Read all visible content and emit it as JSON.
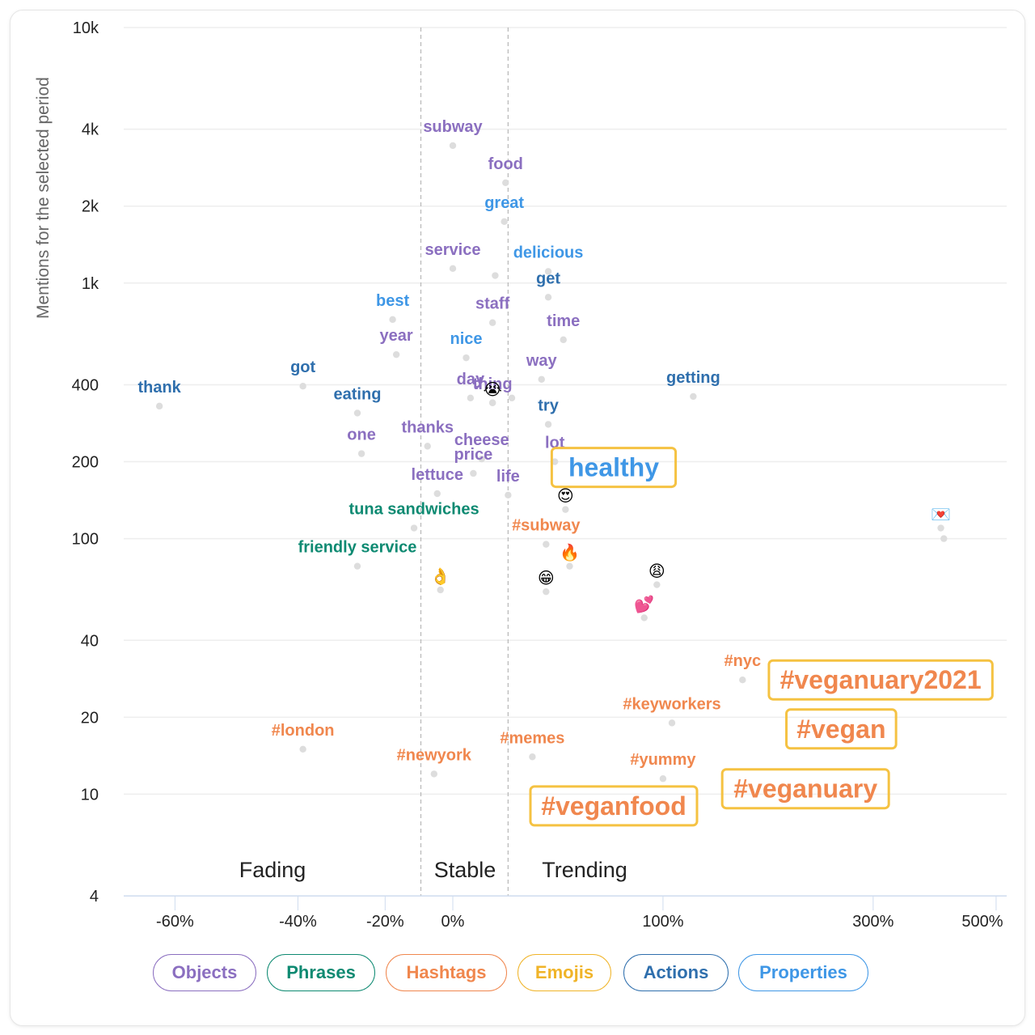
{
  "chart_data": {
    "type": "scatter",
    "title": "",
    "ylabel": "Mentions for the selected period",
    "xlabel": "",
    "y_scale": "log",
    "x_scale": "log(1+x)",
    "ylim": [
      4,
      10000
    ],
    "xlim": [
      -0.7,
      0.5
    ],
    "y_ticks": [
      {
        "value": 10000,
        "label": "10k"
      },
      {
        "value": 4000,
        "label": "4k"
      },
      {
        "value": 2000,
        "label": "2k"
      },
      {
        "value": 1000,
        "label": "1k"
      },
      {
        "value": 400,
        "label": "400"
      },
      {
        "value": 200,
        "label": "200"
      },
      {
        "value": 100,
        "label": "100"
      },
      {
        "value": 40,
        "label": "40"
      },
      {
        "value": 20,
        "label": "20"
      },
      {
        "value": 10,
        "label": "10"
      },
      {
        "value": 4,
        "label": "4"
      }
    ],
    "x_ticks": [
      {
        "value": -60,
        "label": "-60%"
      },
      {
        "value": -40,
        "label": "-40%"
      },
      {
        "value": -20,
        "label": "-20%"
      },
      {
        "value": 0,
        "label": "0%"
      },
      {
        "value": 100,
        "label": "100%"
      },
      {
        "value": 300,
        "label": "300%"
      },
      {
        "value": 500,
        "label": "500%"
      }
    ],
    "zone_boundaries": [
      -10,
      20
    ],
    "zones": [
      {
        "label": "Fading",
        "center": -45
      },
      {
        "label": "Stable",
        "center": 6
      },
      {
        "label": "Trending",
        "center": 60
      }
    ],
    "grid": true,
    "legend_placement": "bottom",
    "categories": {
      "Objects": "#8b6fc0",
      "Phrases": "#0e8a72",
      "Hashtags": "#f0874e",
      "Emojis": "#f0b429",
      "Actions": "#2f6fad",
      "Properties": "#3f97e6"
    },
    "highlight_color": "#f5c242",
    "dot_color": "#dddddd",
    "points": [
      {
        "label": "subway",
        "cat": "Objects",
        "change": 0,
        "mentions": 3450
      },
      {
        "label": "food",
        "cat": "Objects",
        "change": 19,
        "mentions": 2470
      },
      {
        "label": "great",
        "cat": "Properties",
        "change": 18.5,
        "mentions": 1740
      },
      {
        "label": "service",
        "cat": "Objects",
        "change": 0,
        "mentions": 1140
      },
      {
        "label": "",
        "cat": "Objects",
        "change": 15,
        "mentions": 1070
      },
      {
        "label": "delicious",
        "cat": "Properties",
        "change": 37,
        "mentions": 1110
      },
      {
        "label": "get",
        "cat": "Actions",
        "change": 37,
        "mentions": 880
      },
      {
        "label": "best",
        "cat": "Properties",
        "change": -18,
        "mentions": 720
      },
      {
        "label": "staff",
        "cat": "Objects",
        "change": 14,
        "mentions": 700
      },
      {
        "label": "time",
        "cat": "Objects",
        "change": 44,
        "mentions": 600
      },
      {
        "label": "year",
        "cat": "Objects",
        "change": -17,
        "mentions": 525
      },
      {
        "label": "nice",
        "cat": "Properties",
        "change": 4.5,
        "mentions": 510
      },
      {
        "label": "way",
        "cat": "Objects",
        "change": 34,
        "mentions": 420
      },
      {
        "label": "got",
        "cat": "Actions",
        "change": -39,
        "mentions": 395
      },
      {
        "label": "getting",
        "cat": "Actions",
        "change": 121,
        "mentions": 360
      },
      {
        "label": "day",
        "cat": "Objects",
        "change": 6,
        "mentions": 355
      },
      {
        "label": "",
        "cat": "Objects",
        "change": 21.5,
        "mentions": 355
      },
      {
        "label": "thing",
        "cat": "Objects",
        "change": 14,
        "mentions": 340
      },
      {
        "label": "😭",
        "cat": "Emojis",
        "change": 14,
        "mentions": 340
      },
      {
        "label": "thank",
        "cat": "Actions",
        "change": -62,
        "mentions": 330
      },
      {
        "label": "eating",
        "cat": "Actions",
        "change": -27,
        "mentions": 310
      },
      {
        "label": "try",
        "cat": "Actions",
        "change": 37,
        "mentions": 280
      },
      {
        "label": "one",
        "cat": "Objects",
        "change": -26,
        "mentions": 215
      },
      {
        "label": "thanks",
        "cat": "Objects",
        "change": -8,
        "mentions": 230
      },
      {
        "label": "cheese",
        "cat": "Objects",
        "change": 10,
        "mentions": 205
      },
      {
        "label": "lot",
        "cat": "Objects",
        "change": 40,
        "mentions": 200
      },
      {
        "label": "healthy",
        "cat": "Properties",
        "change": 70,
        "mentions": 190,
        "highlight": true
      },
      {
        "label": "price",
        "cat": "Objects",
        "change": 7,
        "mentions": 180
      },
      {
        "label": "life",
        "cat": "Objects",
        "change": 20,
        "mentions": 148
      },
      {
        "label": "lettuce",
        "cat": "Objects",
        "change": -5,
        "mentions": 150
      },
      {
        "label": "😍",
        "cat": "Emojis",
        "change": 45,
        "mentions": 130
      },
      {
        "label": "tuna sandwiches",
        "cat": "Phrases",
        "change": -12,
        "mentions": 110
      },
      {
        "label": "#subway",
        "cat": "Hashtags",
        "change": 36,
        "mentions": 95
      },
      {
        "label": "🔥",
        "cat": "Emojis",
        "change": 47,
        "mentions": 78
      },
      {
        "label": "friendly service",
        "cat": "Phrases",
        "change": -27,
        "mentions": 78
      },
      {
        "label": "👌",
        "cat": "Emojis",
        "change": -4,
        "mentions": 63
      },
      {
        "label": "😁",
        "cat": "Emojis",
        "change": 36,
        "mentions": 62
      },
      {
        "label": "😩",
        "cat": "Emojis",
        "change": 96,
        "mentions": 66
      },
      {
        "label": "💕",
        "cat": "Emojis",
        "change": 88,
        "mentions": 49
      },
      {
        "label": "💌",
        "cat": "Emojis",
        "change": 400,
        "mentions": 110
      },
      {
        "label": "",
        "cat": "Emojis",
        "change": 405,
        "mentions": 100
      },
      {
        "label": "#nyc",
        "cat": "Hashtags",
        "change": 160,
        "mentions": 28
      },
      {
        "label": "#veganuary2021",
        "cat": "Hashtags",
        "change": 310,
        "mentions": 28,
        "highlight": true
      },
      {
        "label": "#keyworkers",
        "cat": "Hashtags",
        "change": 106,
        "mentions": 19
      },
      {
        "label": "#vegan",
        "cat": "Hashtags",
        "change": 260,
        "mentions": 18,
        "highlight": true
      },
      {
        "label": "#london",
        "cat": "Hashtags",
        "change": -39,
        "mentions": 15
      },
      {
        "label": "#memes",
        "cat": "Hashtags",
        "change": 30,
        "mentions": 14
      },
      {
        "label": "#newyork",
        "cat": "Hashtags",
        "change": -6,
        "mentions": 12
      },
      {
        "label": "#yummy",
        "cat": "Hashtags",
        "change": 100,
        "mentions": 11.5
      },
      {
        "label": "#veganuary",
        "cat": "Hashtags",
        "change": 220,
        "mentions": 10.5,
        "highlight": true
      },
      {
        "label": "#veganfood",
        "cat": "Hashtags",
        "change": 70,
        "mentions": 9,
        "highlight": true
      }
    ]
  },
  "legend": {
    "items": [
      {
        "label": "Objects",
        "color": "#8b6fc0"
      },
      {
        "label": "Phrases",
        "color": "#0e8a72"
      },
      {
        "label": "Hashtags",
        "color": "#f0874e"
      },
      {
        "label": "Emojis",
        "color": "#f0b429"
      },
      {
        "label": "Actions",
        "color": "#2f6fad"
      },
      {
        "label": "Properties",
        "color": "#3f97e6"
      }
    ]
  }
}
